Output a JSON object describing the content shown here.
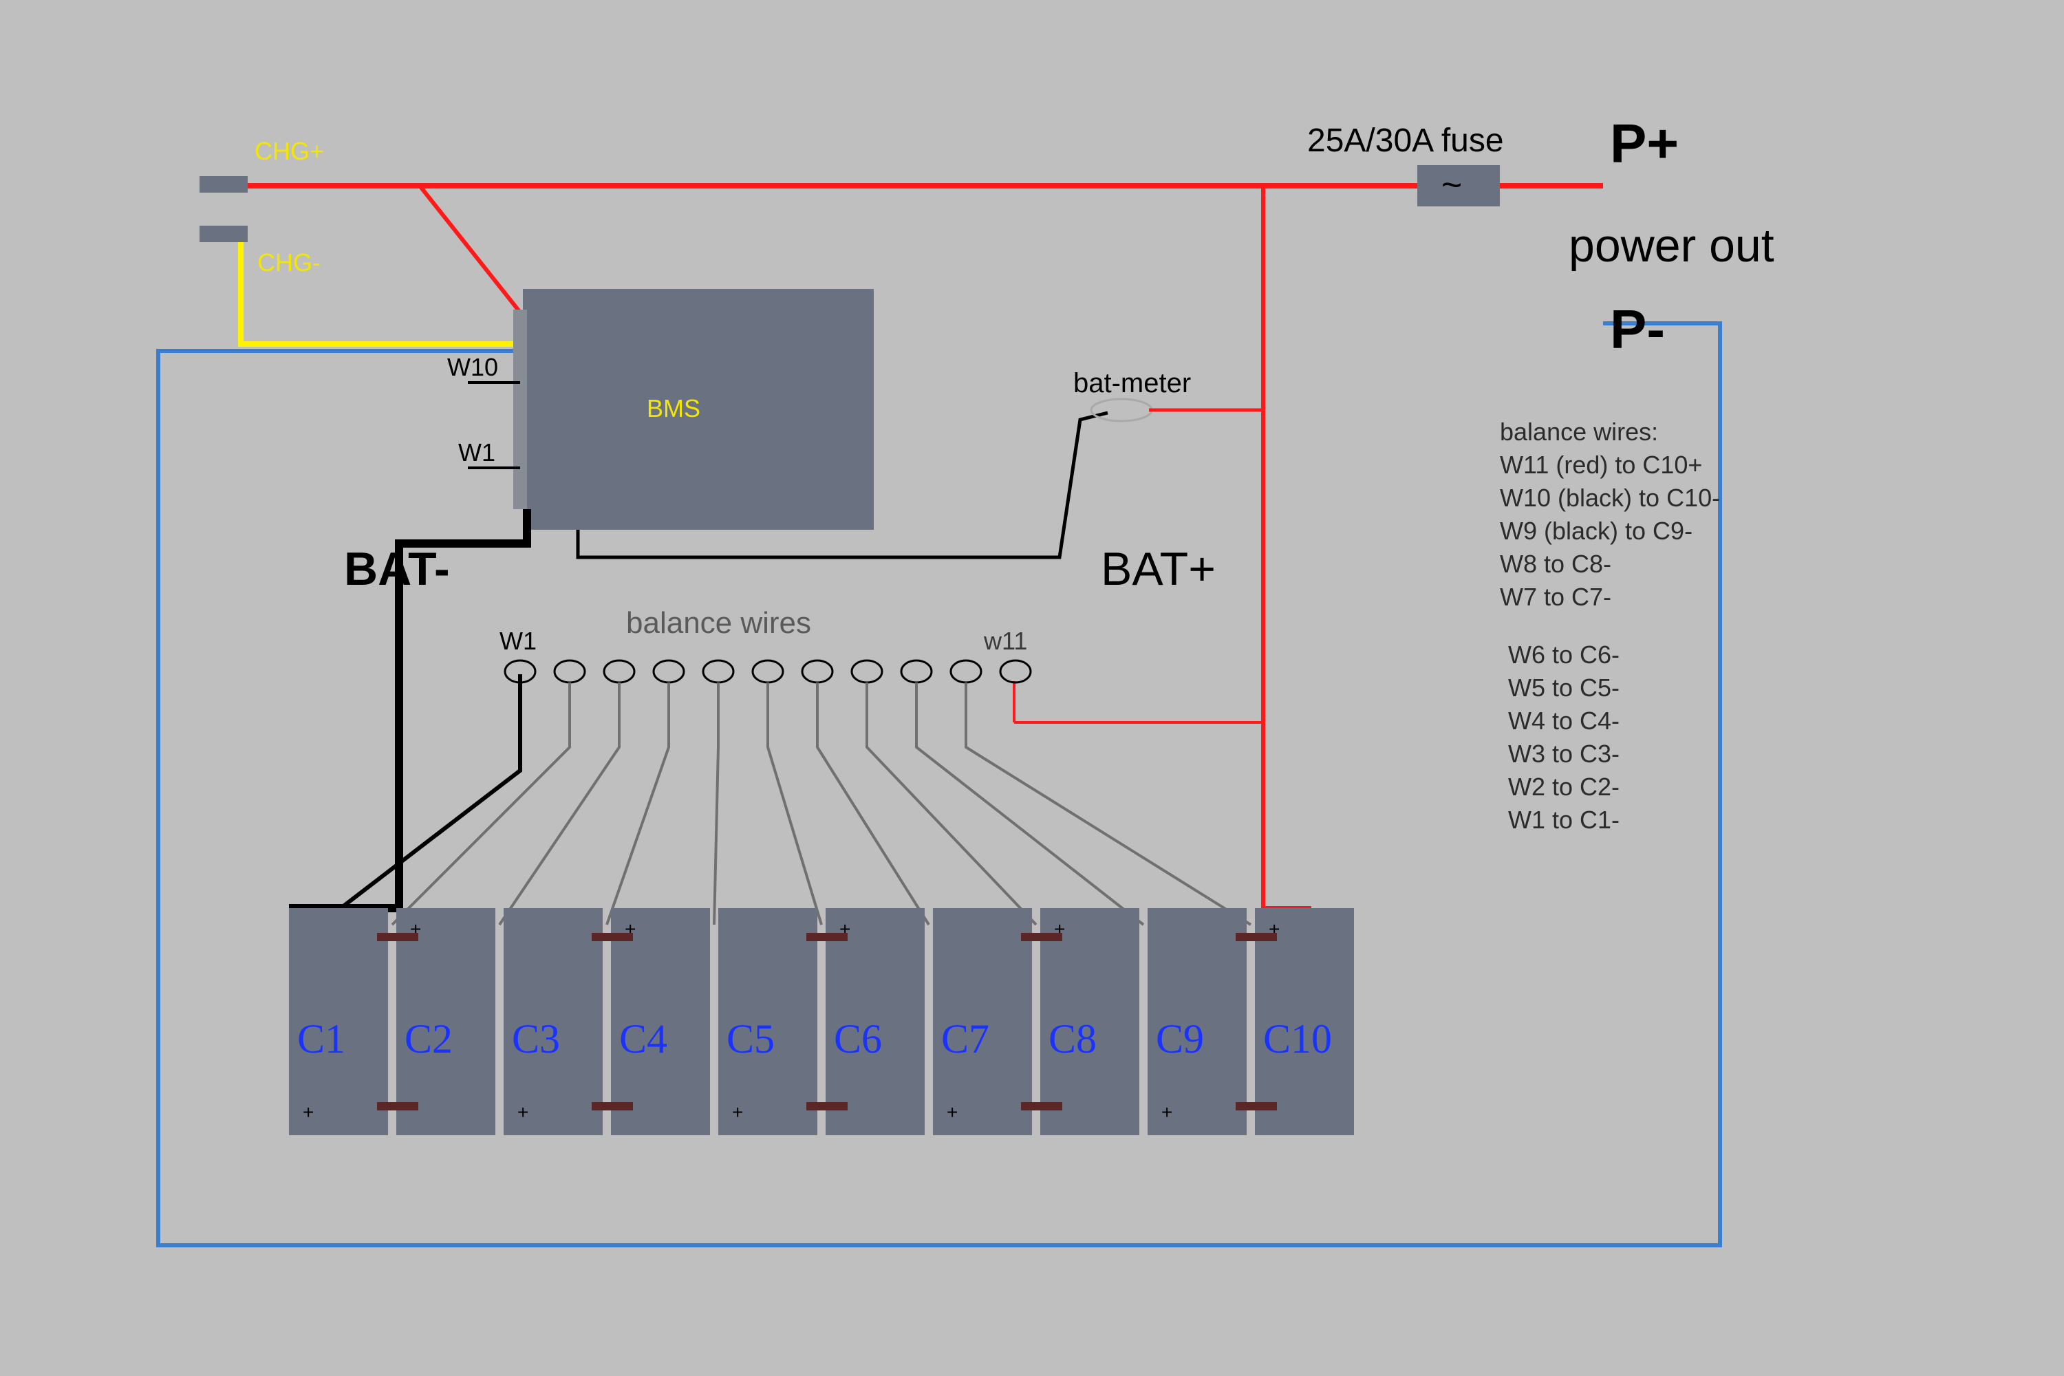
{
  "labels": {
    "chg_pos": "CHG+",
    "chg_neg": "CHG-",
    "bms": "BMS",
    "w10": "W10",
    "w1": "W1",
    "bat_neg": "BAT-",
    "bat_pos": "BAT+",
    "balance_wires": "balance wires",
    "w1b": "W1",
    "w11": "w11",
    "bat_meter": "bat-meter",
    "fuse": "25A/30A fuse",
    "p_pos": "P+",
    "p_neg": "P-",
    "power_out": "power out"
  },
  "cells": [
    "C1",
    "C2",
    "C3",
    "C4",
    "C5",
    "C6",
    "C7",
    "C8",
    "C9",
    "C10"
  ],
  "legend_title": "balance wires:",
  "legend1": [
    "W11 (red) to C10+",
    "W10 (black) to C10-",
    "W9 (black) to C9-",
    "W8 to C8-",
    "W7 to C7-"
  ],
  "legend2": [
    "W6 to C6-",
    "W5 to C5-",
    "W4 to C4-",
    "W3 to C3-",
    "W2 to C2-",
    "W1 to C1-"
  ],
  "colors": {
    "bg": "#bfbfbf",
    "block": "#6a7281",
    "wire_red": "#ff1a1a",
    "wire_yellow": "#fff200",
    "wire_blue": "#3b7ed0",
    "wire_black": "#000000",
    "wire_grey": "#707070",
    "tab": "#5c2626",
    "text_blue": "#1a32ff",
    "text_yellow": "#f3e600",
    "text_dark": "#2b2b2b",
    "text_black": "#000000"
  }
}
